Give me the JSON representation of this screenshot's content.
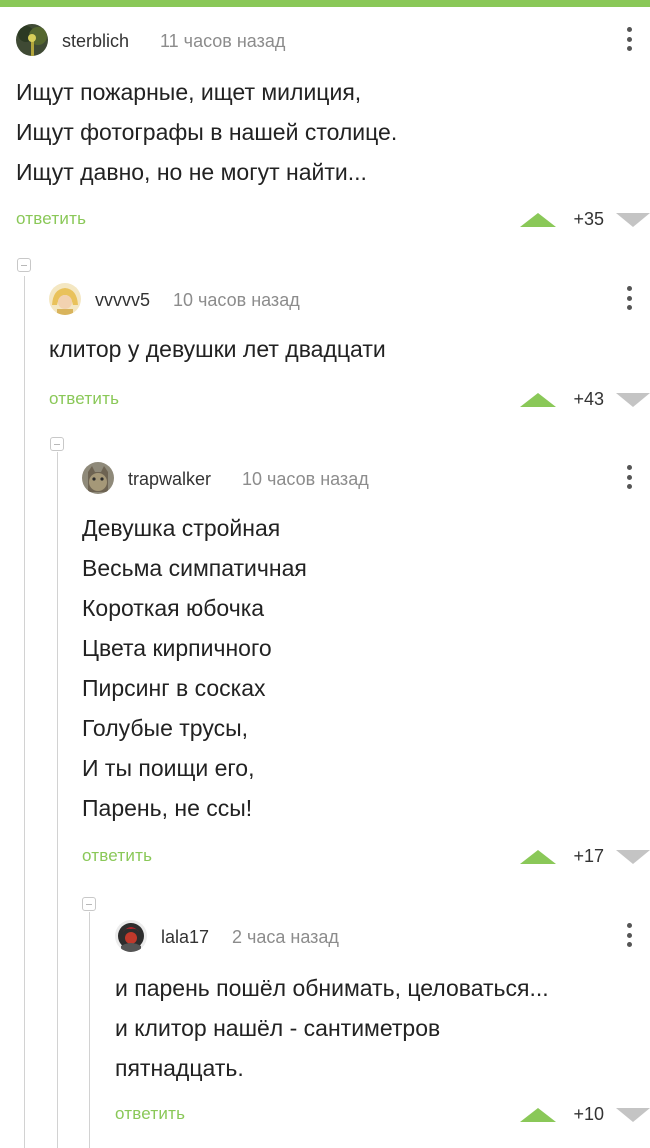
{
  "colors": {
    "accent": "#8ac858",
    "muted": "#8c8c8c",
    "line": "#d2d2d2"
  },
  "comments": [
    {
      "user": "sterblich",
      "time": "11 часов назад",
      "lines": [
        "Ищут пожарные, ищет милиция,",
        "Ищут фотографы в нашей столице.",
        "Ищут давно, но не могут найти..."
      ],
      "reply": "ответить",
      "rating": "+35",
      "avatar_icon": "tree-avatar"
    },
    {
      "user": "vvvvv5",
      "time": "10 часов назад",
      "lines": [
        "клитор у девушки лет двадцати"
      ],
      "reply": "ответить",
      "rating": "+43",
      "avatar_icon": "blond-avatar"
    },
    {
      "user": "trapwalker",
      "time": "10 часов назад",
      "lines": [
        "Девушка стройная",
        "Весьма симпатичная",
        "Короткая юбочка",
        "Цвета кирпичного",
        "Пирсинг в сосках",
        "Голубые трусы,",
        "И ты поищи его,",
        "Парень, не ссы!"
      ],
      "reply": "ответить",
      "rating": "+17",
      "avatar_icon": "cat-avatar"
    },
    {
      "user": "lala17",
      "time": "2 часа назад",
      "lines": [
        "и парень пошёл обнимать, целоваться...",
        "и клитор нашёл - сантиметров",
        "пятнадцать."
      ],
      "reply": "ответить",
      "rating": "+10",
      "avatar_icon": "red-avatar"
    }
  ]
}
